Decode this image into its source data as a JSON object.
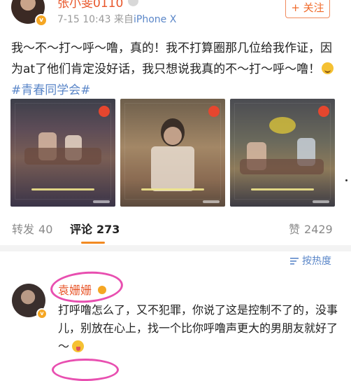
{
  "post": {
    "author_name": "张小斐0110",
    "meta_date": "7-15 10:43",
    "meta_from": "来自",
    "meta_device": "iPhone X",
    "follow_label": "+ 关注",
    "text": "我～不～打～呼～噜，真的！我不打算圈那几位给我作证，因为at了他们肯定没好话，我只想说我真的不～打～呼～噜！",
    "hashtag": "#青春同学会#",
    "image_count": 3
  },
  "actions": {
    "repost_label": "转发",
    "repost_count": "40",
    "comment_label": "评论",
    "comment_count": "273",
    "like_label": "赞",
    "like_count": "2429"
  },
  "sort": {
    "label": "按热度"
  },
  "comment": {
    "author_name": "袁姗姗",
    "text": "打呼噜怎么了，又不犯罪，你说了这是控制不了的，没事儿，别放在心上，找一个比你呼噜声更大的男朋友就好了～"
  },
  "colors": {
    "accent_orange": "#f06a2a",
    "link_blue": "#5a86c8",
    "highlight_pink": "#e84fb0"
  }
}
